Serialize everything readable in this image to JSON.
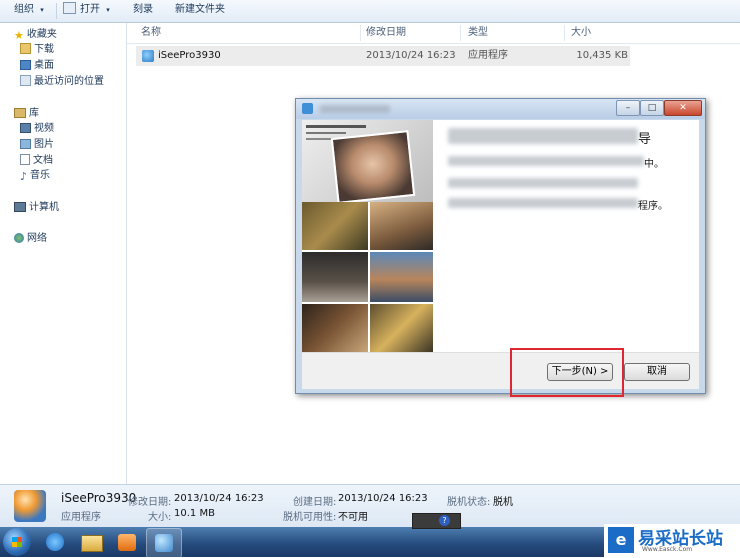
{
  "toolbar": {
    "organize": "组织",
    "open": "打开",
    "burn": "刻录",
    "new_folder": "新建文件夹"
  },
  "nav": {
    "favorites": "收藏夹",
    "downloads": "下载",
    "desktop": "桌面",
    "recent": "最近访问的位置",
    "library": "库",
    "videos": "视频",
    "pictures": "图片",
    "documents": "文档",
    "music": "音乐",
    "computer": "计算机",
    "network": "网络"
  },
  "list": {
    "columns": [
      "名称",
      "修改日期",
      "类型",
      "大小"
    ],
    "rows": [
      {
        "name": "iSeePro3930",
        "modified": "2013/10/24 16:23",
        "type": "应用程序",
        "size": "10,435 KB"
      }
    ]
  },
  "dialog": {
    "visible_text_fragments": [
      "导",
      "中。",
      "程序。"
    ],
    "next_button": "下一步(N) >",
    "cancel_button": "取消",
    "min_glyph": "–",
    "max_glyph": "□",
    "close_glyph": "✕"
  },
  "details": {
    "name": "iSeePro3930",
    "type": "应用程序",
    "modified_label": "修改日期:",
    "modified_value": "2013/10/24 16:23",
    "size_label": "大小:",
    "size_value": "10.1 MB",
    "created_label": "创建日期:",
    "created_value": "2013/10/24 16:23",
    "offline_status_label": "脱机状态:",
    "offline_status_value": "脱机",
    "offline_avail_label": "脱机可用性:",
    "offline_avail_value": "不可用"
  },
  "watermark": {
    "title": "易采站长站",
    "url": "Www.Easck.Com"
  },
  "colors": {
    "highlight": "#e0262f",
    "taskbar": "#24497a"
  }
}
